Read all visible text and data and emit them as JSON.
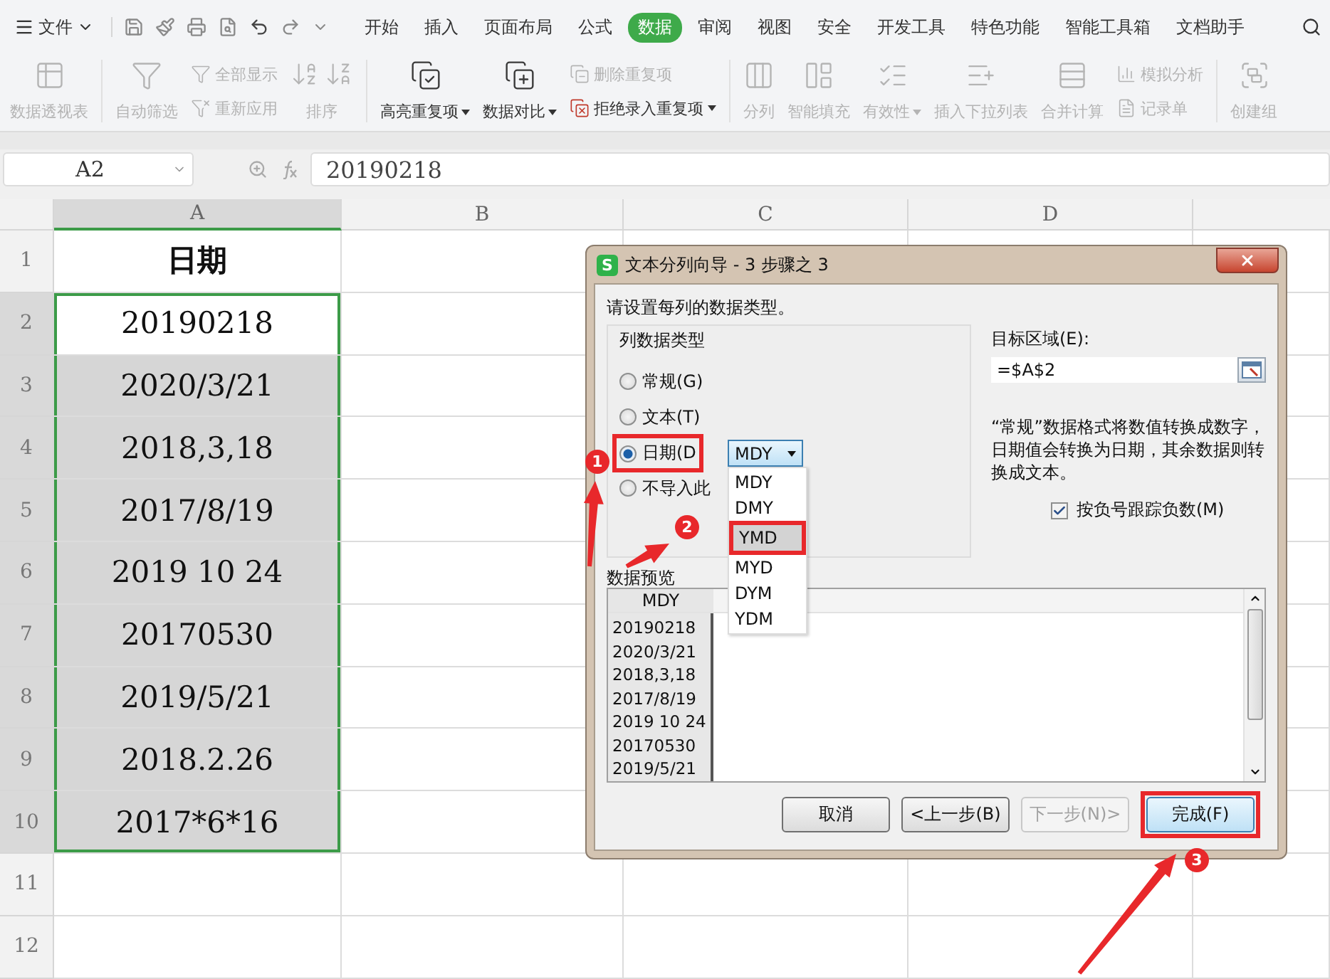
{
  "menu": {
    "file_label": "文件",
    "tabs": [
      {
        "label": "开始",
        "selected": false
      },
      {
        "label": "插入",
        "selected": false
      },
      {
        "label": "页面布局",
        "selected": false
      },
      {
        "label": "公式",
        "selected": false
      },
      {
        "label": "数据",
        "selected": true
      },
      {
        "label": "审阅",
        "selected": false
      },
      {
        "label": "视图",
        "selected": false
      },
      {
        "label": "安全",
        "selected": false
      },
      {
        "label": "开发工具",
        "selected": false
      },
      {
        "label": "特色功能",
        "selected": false
      },
      {
        "label": "智能工具箱",
        "selected": false
      },
      {
        "label": "文档助手",
        "selected": false
      }
    ]
  },
  "ribbon": {
    "items": [
      {
        "kind": "large",
        "label": "数据透视表",
        "disabled": true,
        "dropdown": false
      },
      {
        "kind": "large",
        "label": "自动筛选",
        "disabled": true,
        "dropdown": false
      },
      {
        "kind": "stack",
        "rows": [
          {
            "label": "全部显示",
            "disabled": true,
            "dropdown": false
          },
          {
            "label": "重新应用",
            "disabled": true,
            "dropdown": false
          }
        ]
      },
      {
        "kind": "sort",
        "label": "排序",
        "disabled": true
      },
      {
        "kind": "large",
        "label": "高亮重复项",
        "disabled": false,
        "dropdown": true
      },
      {
        "kind": "large",
        "label": "数据对比",
        "disabled": false,
        "dropdown": true
      },
      {
        "kind": "stack",
        "rows": [
          {
            "label": "删除重复项",
            "disabled": true,
            "dropdown": false
          },
          {
            "label": "拒绝录入重复项",
            "disabled": false,
            "dropdown": true
          }
        ]
      },
      {
        "kind": "large",
        "label": "分列",
        "disabled": true,
        "dropdown": false
      },
      {
        "kind": "large",
        "label": "智能填充",
        "disabled": true,
        "dropdown": false
      },
      {
        "kind": "large",
        "label": "有效性",
        "disabled": true,
        "dropdown": true
      },
      {
        "kind": "large",
        "label": "插入下拉列表",
        "disabled": true,
        "dropdown": false
      },
      {
        "kind": "large",
        "label": "合并计算",
        "disabled": true,
        "dropdown": false
      },
      {
        "kind": "stack",
        "rows": [
          {
            "label": "模拟分析",
            "disabled": true,
            "dropdown": false
          },
          {
            "label": "记录单",
            "disabled": true,
            "dropdown": false
          }
        ]
      },
      {
        "kind": "large",
        "label": "创建组",
        "disabled": true,
        "dropdown": false
      }
    ]
  },
  "formula_bar": {
    "name_box": "A2",
    "formula": "20190218"
  },
  "sheet": {
    "columns": [
      {
        "label": "A",
        "selected": true
      },
      {
        "label": "B",
        "selected": false
      },
      {
        "label": "C",
        "selected": false
      },
      {
        "label": "D",
        "selected": false
      }
    ],
    "rows": [
      {
        "header": "1",
        "kind": "heading",
        "value": "日期",
        "selected": false,
        "shaded": false
      },
      {
        "header": "2",
        "kind": "data",
        "value": "20190218",
        "selected": true,
        "shaded": false
      },
      {
        "header": "3",
        "kind": "data",
        "value": "2020/3/21",
        "selected": true,
        "shaded": true
      },
      {
        "header": "4",
        "kind": "data",
        "value": "2018,3,18",
        "selected": true,
        "shaded": true
      },
      {
        "header": "5",
        "kind": "data",
        "value": "2017/8/19",
        "selected": true,
        "shaded": true
      },
      {
        "header": "6",
        "kind": "data",
        "value": "2019 10 24",
        "selected": true,
        "shaded": true
      },
      {
        "header": "7",
        "kind": "data",
        "value": "20170530",
        "selected": true,
        "shaded": true
      },
      {
        "header": "8",
        "kind": "data",
        "value": "2019/5/21",
        "selected": true,
        "shaded": true
      },
      {
        "header": "9",
        "kind": "data",
        "value": "2018.2.26",
        "selected": true,
        "shaded": true
      },
      {
        "header": "10",
        "kind": "data",
        "value": "2017*6*16",
        "selected": true,
        "shaded": true
      },
      {
        "header": "11",
        "kind": "empty",
        "selected": false,
        "shaded": false
      },
      {
        "header": "12",
        "kind": "empty",
        "selected": false,
        "shaded": false
      }
    ]
  },
  "dialog": {
    "logo_text": "S",
    "title": "文本分列向导 - 3 步骤之 3",
    "instruction": "请设置每列的数据类型。",
    "column_type": {
      "legend": "列数据类型",
      "options": [
        {
          "label": "常规(G)",
          "selected": false,
          "marked": false
        },
        {
          "label": "文本(T)",
          "selected": false,
          "marked": false
        },
        {
          "label": "日期(D",
          "selected": true,
          "marked": true
        },
        {
          "label": "不导入此",
          "selected": false,
          "marked": false
        }
      ]
    },
    "date_format": {
      "value": "MDY",
      "open": true,
      "options": [
        {
          "label": "MDY",
          "highlighted": false,
          "marked": false
        },
        {
          "label": "DMY",
          "highlighted": false,
          "marked": false
        },
        {
          "label": "YMD",
          "highlighted": true,
          "marked": true
        },
        {
          "label": "MYD",
          "highlighted": false,
          "marked": false
        },
        {
          "label": "DYM",
          "highlighted": false,
          "marked": false
        },
        {
          "label": "YDM",
          "highlighted": false,
          "marked": false
        }
      ]
    },
    "target": {
      "label": "目标区域(E):",
      "value": "=$A$2"
    },
    "note": "“常规”数据格式将数值转换成数字，日期值会转换为日期，其余数据则转换成文本。",
    "negative_checkbox": {
      "label": "按负号跟踪负数(M)",
      "checked": true
    },
    "preview": {
      "label": "数据预览",
      "header": "MDY",
      "rows": [
        "20190218",
        "2020/3/21",
        "2018,3,18",
        "2017/8/19",
        "2019 10 24",
        "20170530",
        "2019/5/21"
      ]
    },
    "buttons": [
      {
        "label": "取消",
        "disabled": false,
        "primary": false,
        "marked": false
      },
      {
        "label": "<上一步(B)",
        "disabled": false,
        "primary": false,
        "marked": false
      },
      {
        "label": "下一步(N)>",
        "disabled": true,
        "primary": false,
        "marked": false
      },
      {
        "label": "完成(F)",
        "disabled": false,
        "primary": true,
        "marked": true
      }
    ]
  },
  "annotations": [
    {
      "number": "1"
    },
    {
      "number": "2"
    },
    {
      "number": "3"
    }
  ]
}
